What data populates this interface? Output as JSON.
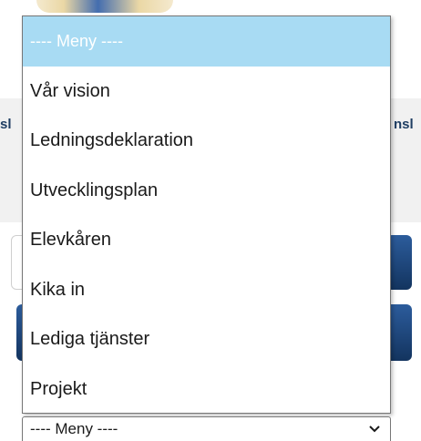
{
  "background": {
    "nav_left_fragment": "sl",
    "nav_right_fragment": "nsl"
  },
  "dropdown": {
    "options": [
      {
        "label": "---- Meny ----",
        "selected": true
      },
      {
        "label": "Vår vision",
        "selected": false
      },
      {
        "label": "Ledningsdeklaration",
        "selected": false
      },
      {
        "label": "Utvecklingsplan",
        "selected": false
      },
      {
        "label": "Elevkåren",
        "selected": false
      },
      {
        "label": "Kika in",
        "selected": false
      },
      {
        "label": "Lediga tjänster",
        "selected": false
      },
      {
        "label": "Projekt",
        "selected": false
      }
    ],
    "current_value": "---- Meny ----",
    "highlight_color": "#a8dbf3"
  },
  "icons": {
    "select_arrow": "chevron-down-icon"
  }
}
